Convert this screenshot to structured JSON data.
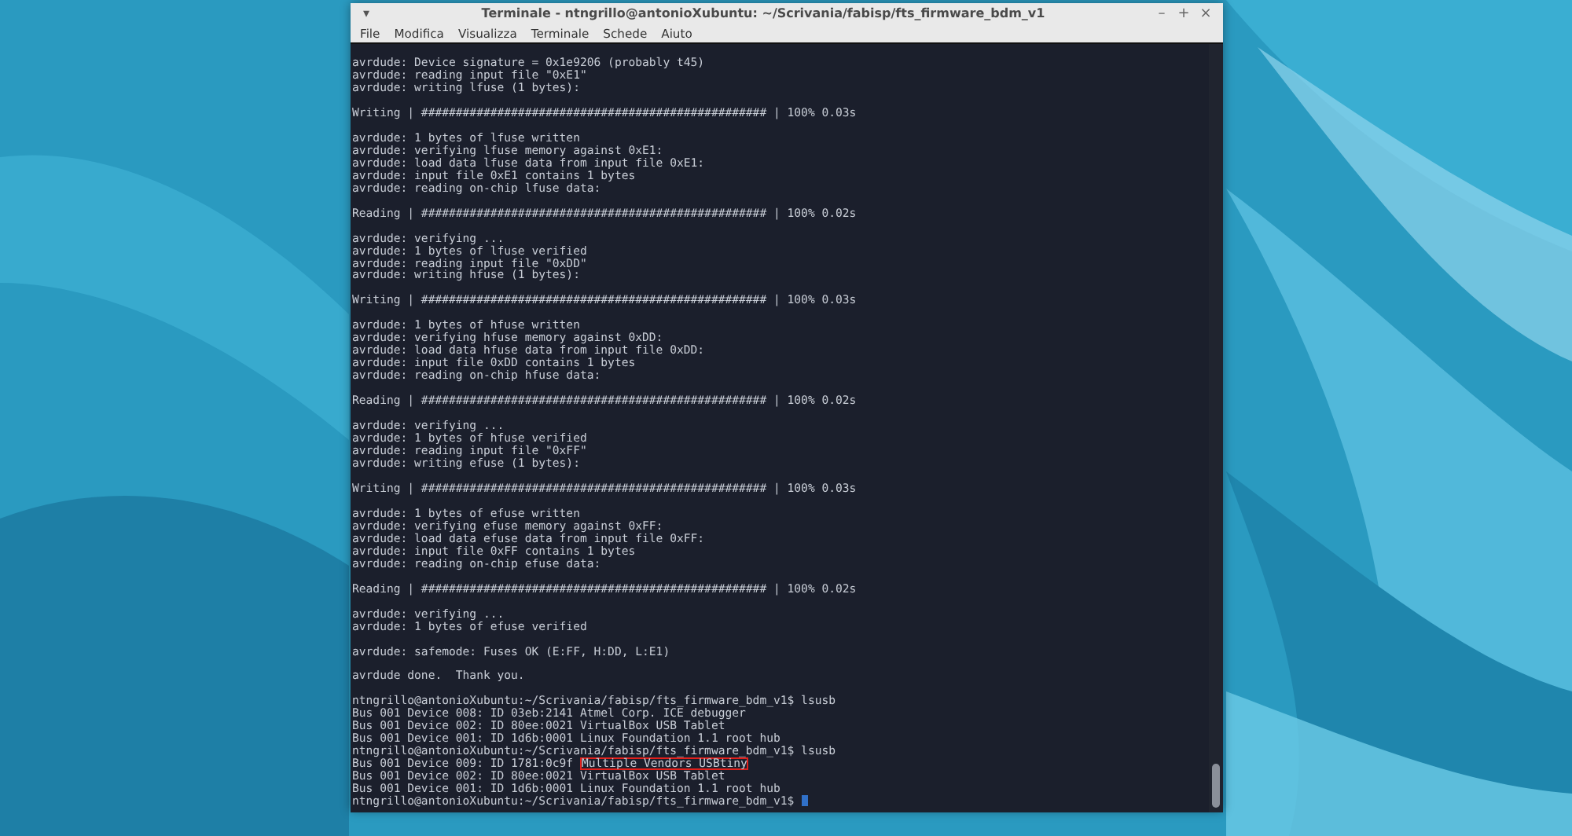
{
  "window": {
    "menu_button": "▾",
    "title": "Terminale - ntngrillo@antonioXubuntu: ~/Scrivania/fabisp/fts_firmware_bdm_v1",
    "controls": [
      "–",
      "+",
      "×"
    ]
  },
  "menu": [
    "File",
    "Modifica",
    "Visualizza",
    "Terminale",
    "Schede",
    "Aiuto"
  ],
  "terminal": {
    "blocks": [
      [
        {
          "text": "avrdude: Device signature = 0x1e9206 (probably t45)"
        },
        {
          "text": "avrdude: reading input file \"0xE1\""
        },
        {
          "text": "avrdude: writing lfuse (1 bytes):"
        }
      ],
      [
        {
          "text": "Writing | ################################################## | 100% 0.03s"
        }
      ],
      [
        {
          "text": "avrdude: 1 bytes of lfuse written"
        },
        {
          "text": "avrdude: verifying lfuse memory against 0xE1:"
        },
        {
          "text": "avrdude: load data lfuse data from input file 0xE1:"
        },
        {
          "text": "avrdude: input file 0xE1 contains 1 bytes"
        },
        {
          "text": "avrdude: reading on-chip lfuse data:"
        }
      ],
      [
        {
          "text": "Reading | ################################################## | 100% 0.02s"
        }
      ],
      [
        {
          "text": "avrdude: verifying ..."
        },
        {
          "text": "avrdude: 1 bytes of lfuse verified"
        },
        {
          "text": "avrdude: reading input file \"0xDD\""
        },
        {
          "text": "avrdude: writing hfuse (1 bytes):"
        }
      ],
      [
        {
          "text": "Writing | ################################################## | 100% 0.03s"
        }
      ],
      [
        {
          "text": "avrdude: 1 bytes of hfuse written"
        },
        {
          "text": "avrdude: verifying hfuse memory against 0xDD:"
        },
        {
          "text": "avrdude: load data hfuse data from input file 0xDD:"
        },
        {
          "text": "avrdude: input file 0xDD contains 1 bytes"
        },
        {
          "text": "avrdude: reading on-chip hfuse data:"
        }
      ],
      [
        {
          "text": "Reading | ################################################## | 100% 0.02s"
        }
      ],
      [
        {
          "text": "avrdude: verifying ..."
        },
        {
          "text": "avrdude: 1 bytes of hfuse verified"
        },
        {
          "text": "avrdude: reading input file \"0xFF\""
        },
        {
          "text": "avrdude: writing efuse (1 bytes):"
        }
      ],
      [
        {
          "text": "Writing | ################################################## | 100% 0.03s"
        }
      ],
      [
        {
          "text": "avrdude: 1 bytes of efuse written"
        },
        {
          "text": "avrdude: verifying efuse memory against 0xFF:"
        },
        {
          "text": "avrdude: load data efuse data from input file 0xFF:"
        },
        {
          "text": "avrdude: input file 0xFF contains 1 bytes"
        },
        {
          "text": "avrdude: reading on-chip efuse data:"
        }
      ],
      [
        {
          "text": "Reading | ################################################## | 100% 0.02s"
        }
      ],
      [
        {
          "text": "avrdude: verifying ..."
        },
        {
          "text": "avrdude: 1 bytes of efuse verified"
        }
      ],
      [
        {
          "text": "avrdude: safemode: Fuses OK (E:FF, H:DD, L:E1)"
        }
      ],
      [
        {
          "text": "avrdude done.  Thank you."
        }
      ],
      [
        {
          "text": "ntngrillo@antonioXubuntu:~/Scrivania/fabisp/fts_firmware_bdm_v1$ lsusb"
        },
        {
          "text": "Bus 001 Device 008: ID 03eb:2141 Atmel Corp. ICE debugger"
        },
        {
          "text": "Bus 001 Device 002: ID 80ee:0021 VirtualBox USB Tablet"
        },
        {
          "text": "Bus 001 Device 001: ID 1d6b:0001 Linux Foundation 1.1 root hub"
        },
        {
          "text": "ntngrillo@antonioXubuntu:~/Scrivania/fabisp/fts_firmware_bdm_v1$ lsusb"
        },
        {
          "text": "Bus 001 Device 009: ID 1781:0c9f ",
          "highlight": "Multiple Vendors USBtiny"
        },
        {
          "text": "Bus 001 Device 002: ID 80ee:0021 VirtualBox USB Tablet"
        },
        {
          "text": "Bus 001 Device 001: ID 1d6b:0001 Linux Foundation 1.1 root hub"
        },
        {
          "text": "ntngrillo@antonioXubuntu:~/Scrivania/fabisp/fts_firmware_bdm_v1$ ",
          "cursor": true
        }
      ]
    ]
  }
}
